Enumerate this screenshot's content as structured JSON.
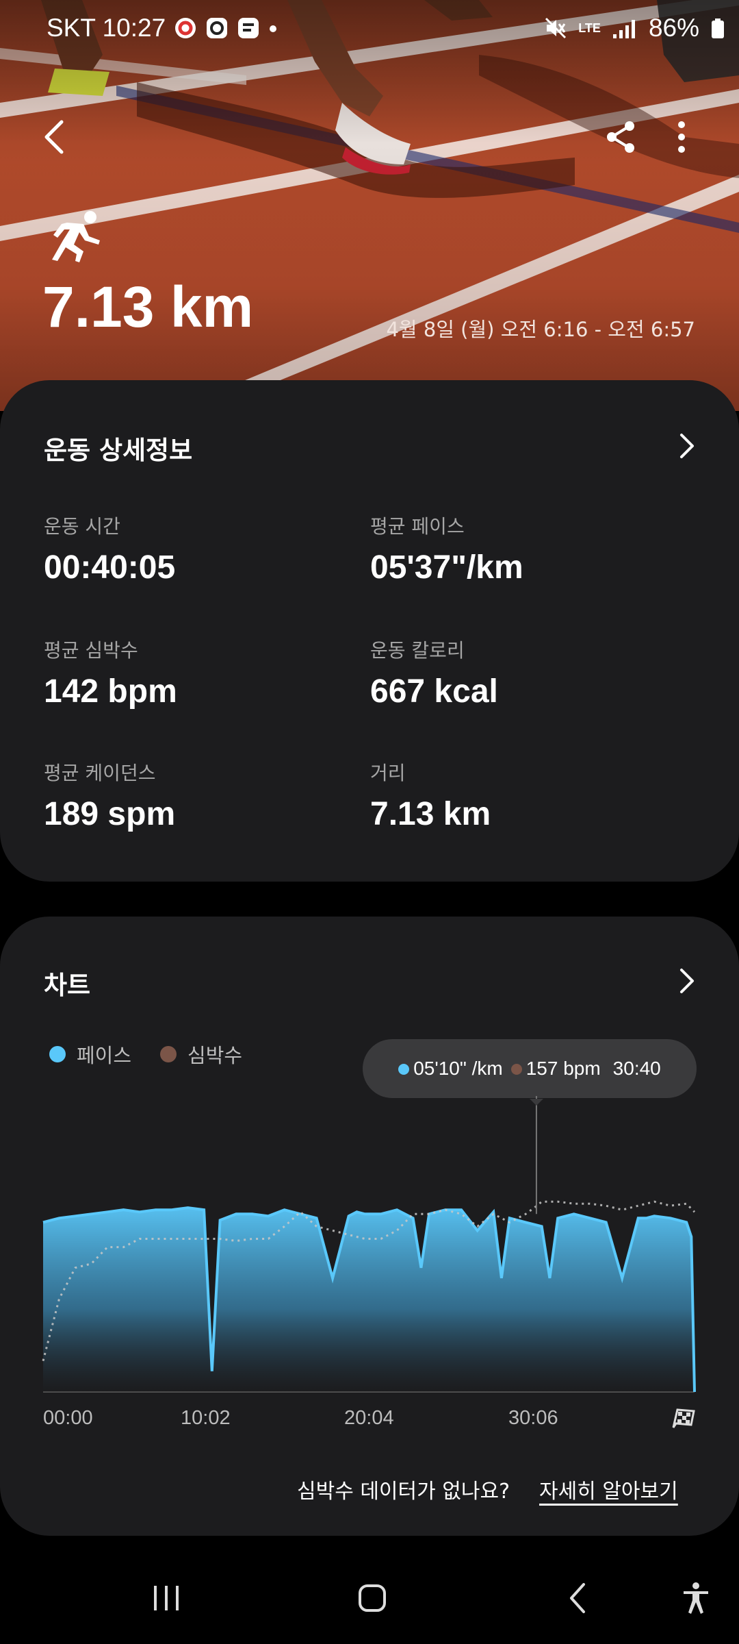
{
  "status_bar": {
    "carrier_time": "SKT 10:27",
    "battery": "86%",
    "network": "LTE",
    "icons": [
      "notification-app-icon",
      "notification-app-icon",
      "notification-app-icon",
      "dot-icon",
      "mute-icon",
      "lte-icon",
      "signal-icon",
      "battery-icon"
    ]
  },
  "header": {
    "back_icon": "back-arrow-icon",
    "share_icon": "share-icon",
    "more_icon": "more-vertical-icon",
    "activity_icon": "running-person-icon",
    "distance": "7.13 km",
    "date_range": "4월 8일 (월) 오전 6:16 - 오전 6:57"
  },
  "details": {
    "title": "운동 상세정보",
    "stats": [
      {
        "label": "운동 시간",
        "value": "00:40:05"
      },
      {
        "label": "평균 페이스",
        "value": "05'37\"/km"
      },
      {
        "label": "평균 심박수",
        "value": "142 bpm"
      },
      {
        "label": "운동 칼로리",
        "value": "667 kcal"
      },
      {
        "label": "평균 케이던스",
        "value": "189 spm"
      },
      {
        "label": "거리",
        "value": "7.13 km"
      }
    ]
  },
  "chart": {
    "title": "차트",
    "legend": [
      {
        "label": "페이스",
        "color": "#5ac8fa"
      },
      {
        "label": "심박수",
        "color": "#7b5548"
      }
    ],
    "tooltip": {
      "pace": "05'10\" /km",
      "heart_rate": "157 bpm",
      "time": "30:40"
    },
    "x_ticks": [
      "00:00",
      "10:02",
      "20:04",
      "30:06"
    ],
    "finish_icon": "checkered-flag-icon",
    "help_question": "심박수 데이터가 없나요?",
    "help_link": "자세히 알아보기"
  },
  "chart_data": {
    "type": "area",
    "title": "",
    "xlabel": "",
    "ylabel": "",
    "x_unit": "minutes",
    "x_ticks": [
      "00:00",
      "10:02",
      "20:04",
      "30:06"
    ],
    "series": [
      {
        "name": "페이스",
        "color": "#5ac8fa",
        "x": [
          0,
          1,
          2,
          3,
          4,
          5,
          6,
          7,
          8,
          9,
          10,
          10.5,
          11,
          12,
          13,
          14,
          15,
          16,
          17,
          18,
          19,
          19.5,
          20,
          21,
          22,
          23,
          23.5,
          24,
          25,
          26,
          27,
          28,
          28.5,
          29,
          30,
          31,
          31.5,
          32,
          33,
          34,
          35,
          36,
          37,
          37.5,
          38,
          39,
          40,
          40.3,
          40.5
        ],
        "values": [
          0.82,
          0.84,
          0.85,
          0.86,
          0.87,
          0.88,
          0.87,
          0.88,
          0.88,
          0.89,
          0.88,
          0.1,
          0.83,
          0.86,
          0.86,
          0.85,
          0.88,
          0.86,
          0.84,
          0.55,
          0.85,
          0.87,
          0.86,
          0.86,
          0.88,
          0.84,
          0.6,
          0.86,
          0.88,
          0.88,
          0.78,
          0.87,
          0.55,
          0.84,
          0.82,
          0.8,
          0.55,
          0.84,
          0.86,
          0.84,
          0.82,
          0.55,
          0.84,
          0.84,
          0.85,
          0.84,
          0.82,
          0.75,
          0.0
        ]
      },
      {
        "name": "심박수",
        "color": "#7b5548",
        "x": [
          0,
          1,
          2,
          3,
          4,
          5,
          6,
          7,
          8,
          9,
          10,
          11,
          12,
          13,
          14,
          15,
          16,
          17,
          18,
          19,
          20,
          21,
          22,
          23,
          24,
          25,
          26,
          27,
          28,
          29,
          30,
          30.7,
          31,
          32,
          33,
          34,
          35,
          36,
          37,
          38,
          39,
          40,
          40.5
        ],
        "values": [
          0.15,
          0.45,
          0.6,
          0.62,
          0.7,
          0.7,
          0.74,
          0.74,
          0.74,
          0.74,
          0.74,
          0.74,
          0.73,
          0.74,
          0.74,
          0.8,
          0.87,
          0.8,
          0.78,
          0.76,
          0.74,
          0.74,
          0.78,
          0.86,
          0.86,
          0.88,
          0.86,
          0.8,
          0.86,
          0.82,
          0.86,
          0.9,
          0.92,
          0.92,
          0.91,
          0.91,
          0.9,
          0.88,
          0.9,
          0.92,
          0.9,
          0.91,
          0.87
        ]
      }
    ],
    "ylim": [
      0,
      1
    ],
    "grid": false,
    "legend_position": "top-left"
  },
  "nav_bar": {
    "recents_icon": "recents-icon",
    "home_icon": "home-icon",
    "back_icon": "nav-back-icon",
    "accessibility_icon": "accessibility-icon"
  }
}
